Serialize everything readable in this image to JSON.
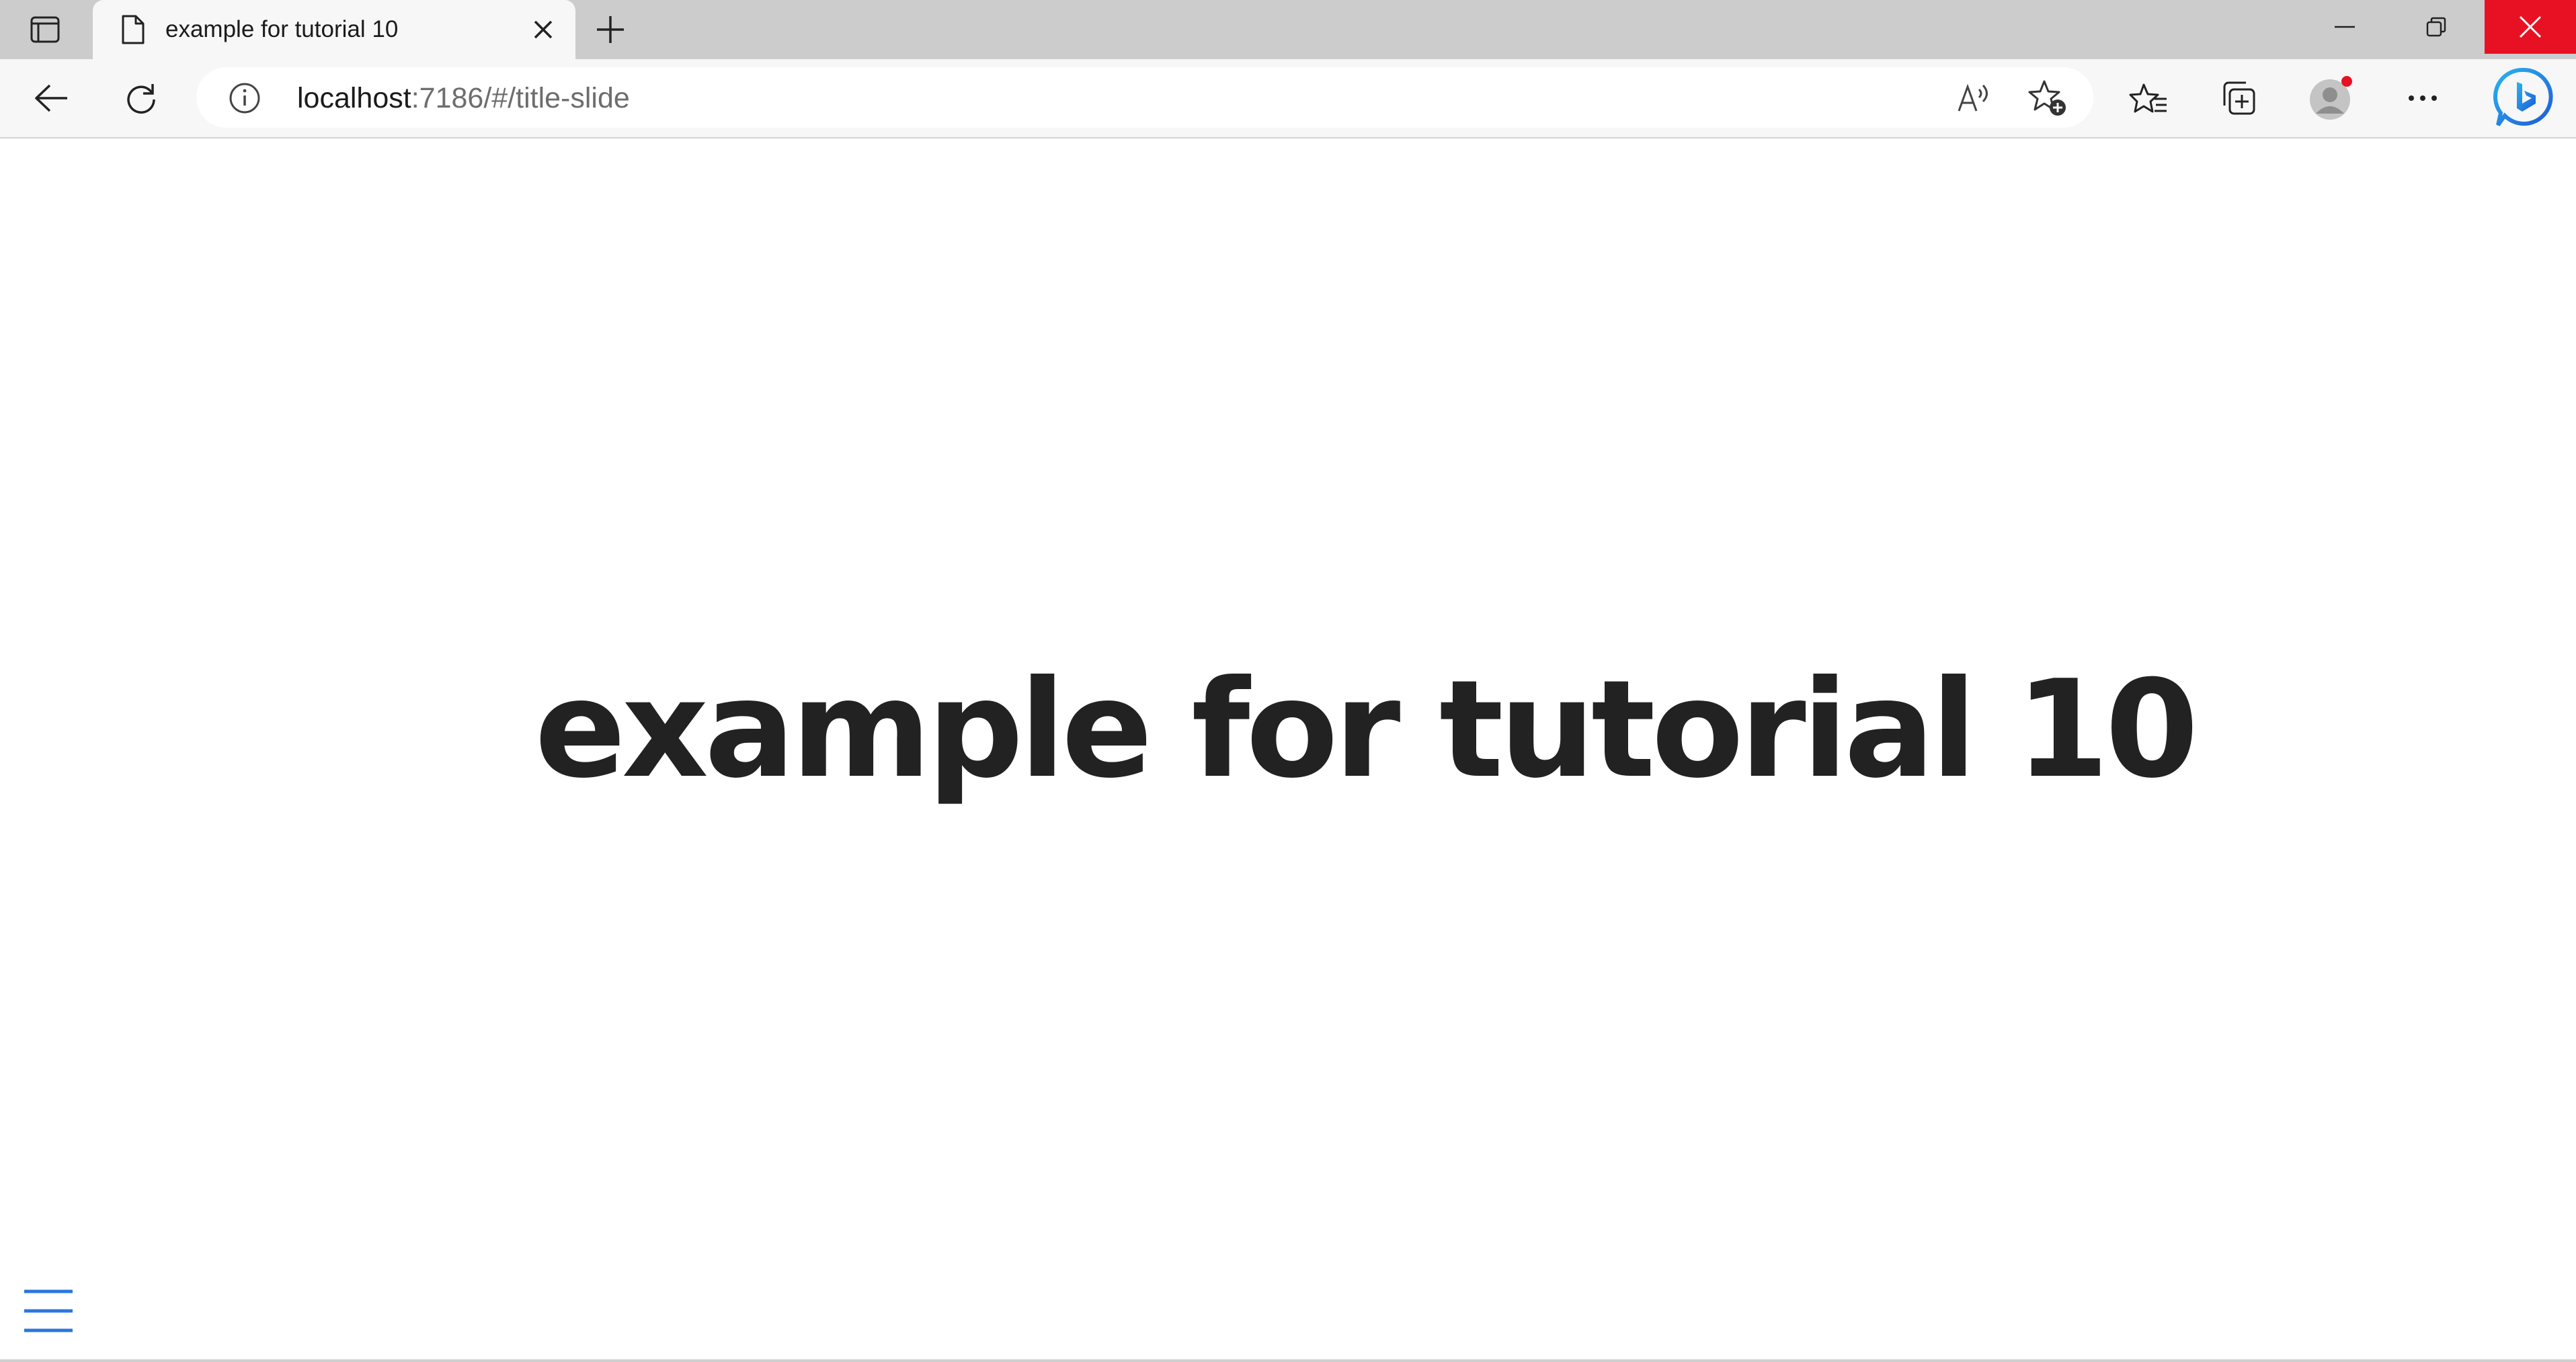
{
  "browser": {
    "tab": {
      "title": "example for tutorial 10"
    },
    "address": {
      "host": "localhost",
      "path": ":7186/#/title-slide"
    },
    "profile_notification_color": "#e81123",
    "close_button_color": "#e81123"
  },
  "toolbar_icons": {
    "back": "back-arrow-icon",
    "refresh": "refresh-icon",
    "info": "info-icon",
    "read_aloud": "read-aloud-icon",
    "add_favorite": "add-favorite-icon",
    "favorites": "favorites-icon",
    "collections": "collections-icon",
    "profile": "profile-icon",
    "more": "more-options-icon",
    "bing": "bing-copilot-icon"
  },
  "slide": {
    "title": "example for tutorial 10",
    "menu_icon": "hamburger-menu-icon",
    "menu_color": "#2a76dd"
  }
}
